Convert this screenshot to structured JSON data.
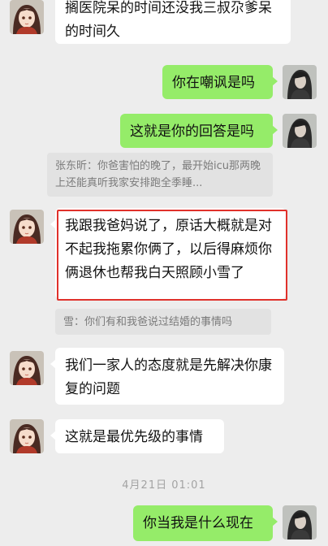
{
  "messages": [
    {
      "id": "m1",
      "side": "in",
      "text": "搁医院呆的时间还没我三叔尕爹呆的时间久"
    },
    {
      "id": "m2",
      "side": "out",
      "text": "你在嘲讽是吗"
    },
    {
      "id": "m3",
      "side": "out",
      "text": "这就是你的回答是吗"
    },
    {
      "id": "q1",
      "type": "quote",
      "text": "张东昕：你爸害怕的晚了，最开始icu那两晚上还能真听我家安排跑全季睡..."
    },
    {
      "id": "m4",
      "side": "in",
      "text": "我跟我爸妈说了，原话大概就是对不起我拖累你俩了，以后得麻烦你俩退休也帮我白天照顾小雪了",
      "highlighted": true
    },
    {
      "id": "q2",
      "type": "quote",
      "text": "雪：你们有和我爸说过结婚的事情吗"
    },
    {
      "id": "m5",
      "side": "in",
      "text": "我们一家人的态度就是先解决你康复的问题"
    },
    {
      "id": "m6",
      "side": "in",
      "text": "这就是最优先级的事情"
    },
    {
      "id": "t1",
      "type": "timestamp",
      "text": "4月21日 01:01"
    },
    {
      "id": "m7",
      "side": "out",
      "text": "你当我是什么现在"
    }
  ],
  "colors": {
    "background": "#ededed",
    "incoming_bubble": "#ffffff",
    "outgoing_bubble": "#95ec69",
    "quote_bubble": "#e2e2e2",
    "highlight_border": "#e0312b"
  },
  "avatars": {
    "contact": "anime-girl-avatar",
    "self": "dark-haired-portrait-avatar"
  }
}
